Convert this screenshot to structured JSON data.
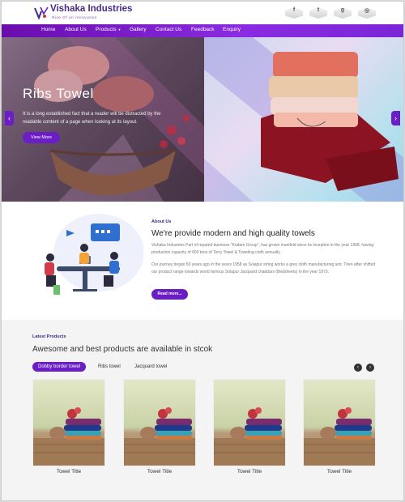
{
  "header": {
    "brand": "Vishaka Industries",
    "tagline": "Rise Of an Innovation",
    "social_icons": [
      "facebook-icon",
      "twitter-icon",
      "google-plus-icon",
      "instagram-icon"
    ]
  },
  "nav": {
    "items": [
      "Home",
      "About Us",
      "Products",
      "Gallery",
      "Contact Us",
      "Feedback",
      "Enquiry"
    ]
  },
  "hero": {
    "title": "Ribs Towel",
    "text": "It is a long established fact that a reader will be distracted by the readable content of a page when looking at its layout.",
    "button": "View More",
    "prev_symbol": "‹",
    "next_symbol": "›"
  },
  "about": {
    "label": "About Us",
    "title": "We're provide modern and high quality towels",
    "p1": "Vishaka Industries Part of reputed business \"Kodam Group\", has grown manifold since its inception in the year 1968, having production capacity of 600 tons of Terry Towel & Toweling cloth annually.",
    "p2": "Our journey began 50 years ago in the years 1958 as Solapur string works a grey cloth manufacturing unit. Then after shifted our product range towards world famous Solapur Jacquard chaddars (Bedsheets) in the year 1973.",
    "button": "Read more..."
  },
  "products": {
    "label": "Latest Products",
    "title": "Awesome and best products are available in stcok",
    "tabs": [
      "Dobby border towel",
      "Ribs towel",
      "Jacquard towel"
    ],
    "prev_symbol": "‹",
    "next_symbol": "›",
    "cards": [
      {
        "title": "Towel Title"
      },
      {
        "title": "Towel Title"
      },
      {
        "title": "Towel Title"
      },
      {
        "title": "Towel Title"
      }
    ]
  },
  "colors": {
    "accent": "#6b1ec5",
    "nav_bg": "#8a2be2"
  }
}
